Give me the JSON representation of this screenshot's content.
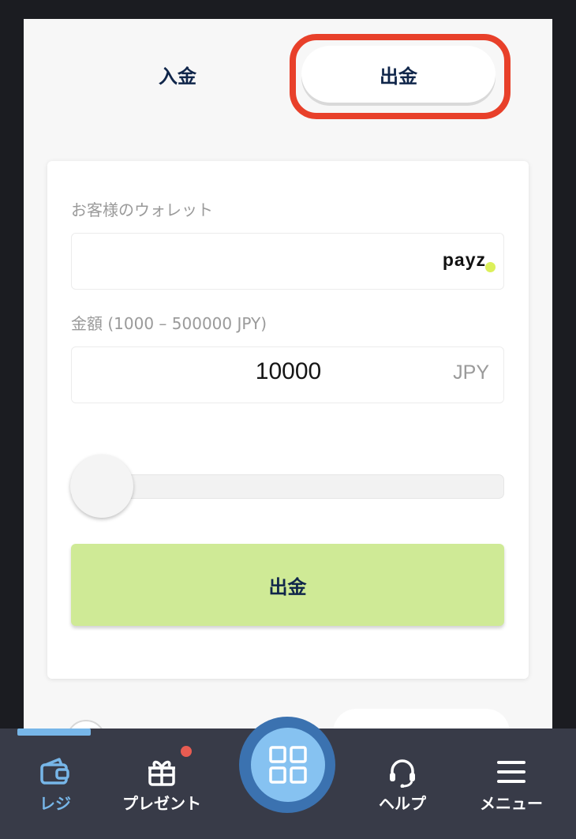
{
  "tabs": {
    "deposit_label": "入金",
    "withdraw_label": "出金"
  },
  "form": {
    "wallet_label": "お客様のウォレット",
    "wallet_logo_text": "payz",
    "amount_label": "金額 (1000 – 500000 JPY)",
    "amount_value": "10000",
    "amount_currency": "JPY",
    "slider_level": 0,
    "submit_label": "出金"
  },
  "nav": {
    "cashier_label": "レジ",
    "gift_label": "プレゼント",
    "help_label": "ヘルプ",
    "menu_label": "メニュー"
  },
  "icons": {
    "cashier": "wallet-icon",
    "gift": "gift-icon",
    "center": "grid-icon",
    "help": "headset-icon",
    "menu": "hamburger-icon"
  },
  "colors": {
    "highlight_ring": "#e8402a",
    "submit_button": "#cfea96",
    "active_nav": "#77b6e8",
    "nav_background": "#383b48",
    "center_button": "#86c2f1",
    "notification_dot": "#e85c52"
  }
}
